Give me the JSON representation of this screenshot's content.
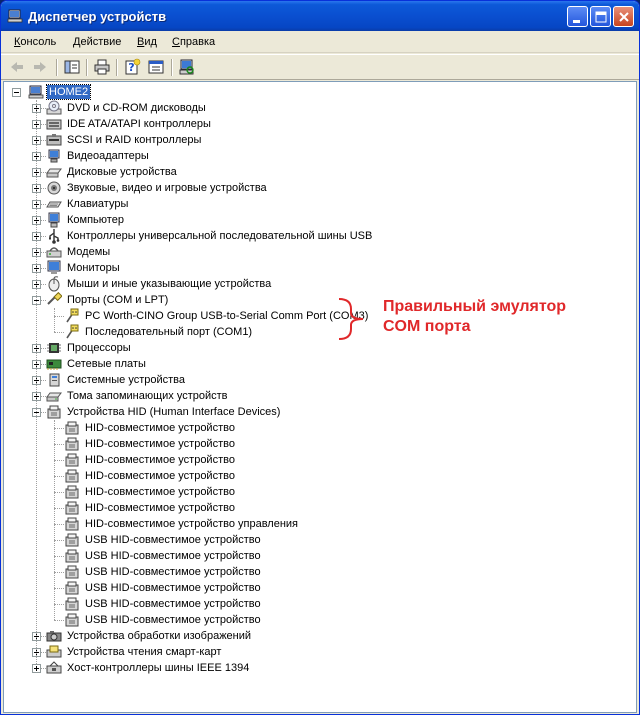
{
  "window": {
    "title": "Диспетчер устройств"
  },
  "menu": [
    {
      "pre": "",
      "u": "К",
      "post": "онсоль"
    },
    {
      "pre": "",
      "u": "Д",
      "post": "ействие"
    },
    {
      "pre": "",
      "u": "В",
      "post": "ид"
    },
    {
      "pre": "",
      "u": "С",
      "post": "правка"
    }
  ],
  "toolbar": {
    "buttons": [
      "back-icon",
      "forward-icon",
      "console-tree-icon",
      "print-icon",
      "properties-help-icon",
      "properties-icon",
      "scan-hardware-icon"
    ]
  },
  "tree": {
    "root": "HOME2",
    "categories": [
      {
        "label": "DVD и CD-ROM дисководы",
        "icon": "cdrom-icon"
      },
      {
        "label": "IDE ATA/ATAPI контроллеры",
        "icon": "ide-controller-icon"
      },
      {
        "label": "SCSI и RAID контроллеры",
        "icon": "scsi-controller-icon"
      },
      {
        "label": "Видеоадаптеры",
        "icon": "display-adapter-icon"
      },
      {
        "label": "Дисковые устройства",
        "icon": "disk-drive-icon"
      },
      {
        "label": "Звуковые, видео и игровые устройства",
        "icon": "sound-device-icon"
      },
      {
        "label": "Клавиатуры",
        "icon": "keyboard-icon"
      },
      {
        "label": "Компьютер",
        "icon": "computer-icon"
      },
      {
        "label": "Контроллеры универсальной последовательной шины USB",
        "icon": "usb-icon"
      },
      {
        "label": "Модемы",
        "icon": "modem-icon"
      },
      {
        "label": "Мониторы",
        "icon": "monitor-icon"
      },
      {
        "label": "Мыши и иные указывающие устройства",
        "icon": "mouse-icon"
      },
      {
        "label": "Порты (COM и LPT)",
        "icon": "port-icon",
        "children": [
          "PC Worth-CINO Group USB-to-Serial Comm Port (COM3)",
          "Последовательный порт (COM1)"
        ]
      },
      {
        "label": "Процессоры",
        "icon": "processor-icon"
      },
      {
        "label": "Сетевые платы",
        "icon": "network-card-icon"
      },
      {
        "label": "Системные устройства",
        "icon": "system-device-icon"
      },
      {
        "label": "Тома запоминающих устройств",
        "icon": "storage-volume-icon"
      },
      {
        "label": "Устройства HID (Human Interface Devices)",
        "icon": "hid-icon",
        "children": [
          "HID-совместимое устройство",
          "HID-совместимое устройство",
          "HID-совместимое устройство",
          "HID-совместимое устройство",
          "HID-совместимое устройство",
          "HID-совместимое устройство",
          "HID-совместимое устройство управления",
          "USB HID-совместимое устройство",
          "USB HID-совместимое устройство",
          "USB HID-совместимое устройство",
          "USB HID-совместимое устройство",
          "USB HID-совместимое устройство",
          "USB HID-совместимое устройство"
        ]
      },
      {
        "label": "Устройства обработки изображений",
        "icon": "imaging-device-icon"
      },
      {
        "label": "Устройства чтения смарт-карт",
        "icon": "smartcard-reader-icon"
      },
      {
        "label": "Хост-контроллеры шины IEEE 1394",
        "icon": "ieee1394-icon"
      }
    ]
  },
  "annotation": {
    "line1": "Правильный эмулятор",
    "line2": "COM порта",
    "color": "#e0282a"
  }
}
